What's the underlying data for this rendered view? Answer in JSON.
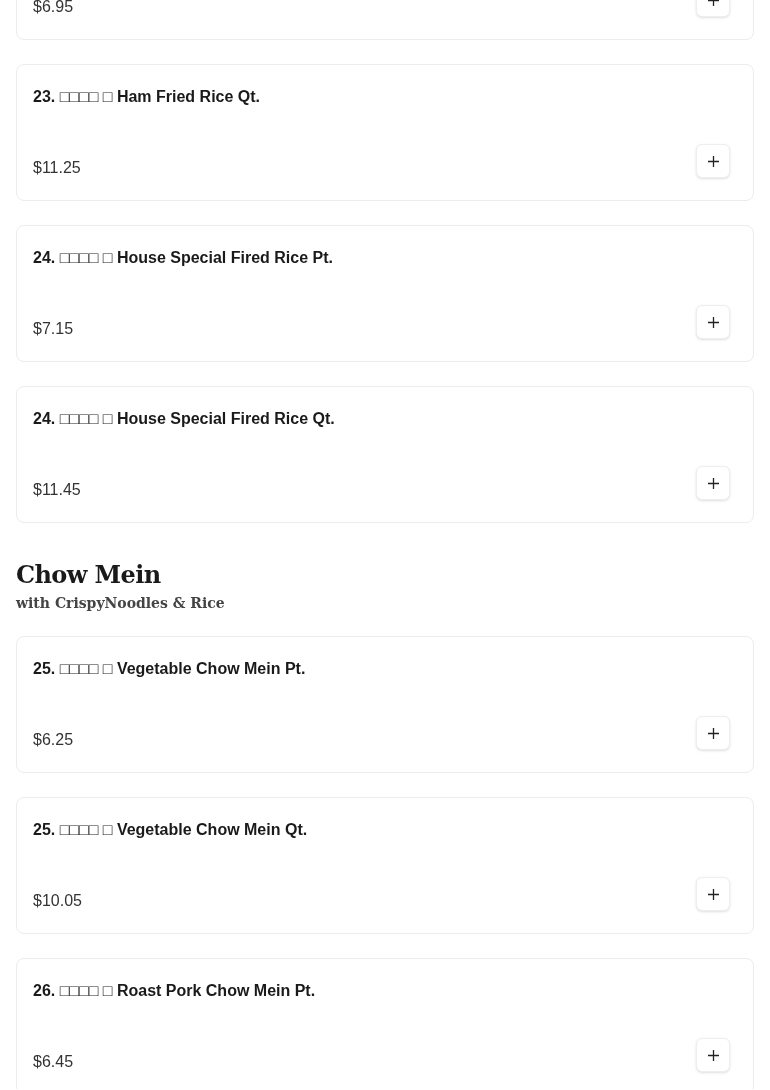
{
  "sections": [
    {
      "items": [
        {
          "price": "$6.95"
        },
        {
          "name": "23. □□□□ □ Ham Fried Rice Qt.",
          "price": "$11.25"
        },
        {
          "name": "24. □□□□ □ House Special Fired Rice Pt.",
          "price": "$7.15"
        },
        {
          "name": "24. □□□□ □ House Special Fired Rice Qt.",
          "price": "$11.45"
        }
      ]
    },
    {
      "title": "Chow Mein",
      "subtitle": "with CrispyNoodles & Rice",
      "items": [
        {
          "name": "25. □□□□ □ Vegetable Chow Mein Pt.",
          "price": "$6.25"
        },
        {
          "name": "25. □□□□ □ Vegetable Chow Mein Qt.",
          "price": "$10.05"
        },
        {
          "name": "26. □□□□ □ Roast Pork Chow Mein Pt.",
          "price": "$6.45"
        }
      ]
    }
  ]
}
